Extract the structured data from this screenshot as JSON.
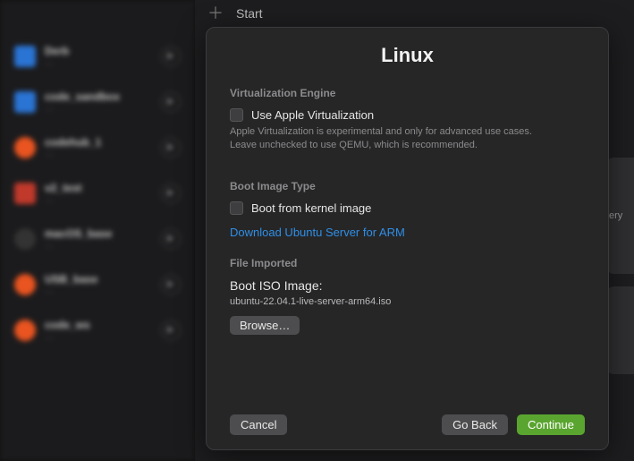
{
  "toolbar": {
    "start_label": "Start"
  },
  "sidebar": {
    "items": [
      {
        "name": "Derb",
        "sub": "…"
      },
      {
        "name": "code_sandbox",
        "sub": "…"
      },
      {
        "name": "codehub_1",
        "sub": "…"
      },
      {
        "name": "v2_test",
        "sub": "…"
      },
      {
        "name": "macOS_base",
        "sub": "…"
      },
      {
        "name": "USB_base",
        "sub": "…"
      },
      {
        "name": "code_ws",
        "sub": "…"
      }
    ]
  },
  "modal": {
    "title": "Linux",
    "sections": {
      "virt_engine": {
        "heading": "Virtualization Engine",
        "checkbox_label": "Use Apple Virtualization",
        "checked": false,
        "hint": "Apple Virtualization is experimental and only for advanced use cases. Leave unchecked to use QEMU, which is recommended."
      },
      "boot_image": {
        "heading": "Boot Image Type",
        "checkbox_label": "Boot from kernel image",
        "checked": false,
        "link_text": "Download Ubuntu Server for ARM"
      },
      "file_imported": {
        "heading": "File Imported",
        "field_label": "Boot ISO Image:",
        "file_name": "ubuntu-22.04.1-live-server-arm64.iso",
        "browse_label": "Browse…"
      }
    },
    "buttons": {
      "cancel": "Cancel",
      "go_back": "Go Back",
      "continue": "Continue"
    }
  },
  "peek_text": "ery"
}
